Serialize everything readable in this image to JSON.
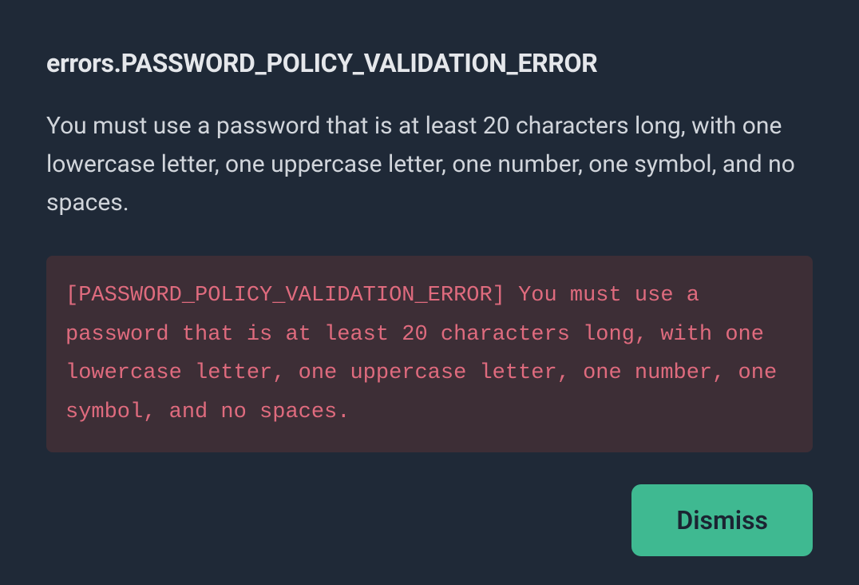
{
  "dialog": {
    "title": "errors.PASSWORD_POLICY_VALIDATION_ERROR",
    "message": "You must use a password that is at least 20 characters long, with one lowercase letter, one uppercase letter, one number, one symbol, and no spaces.",
    "error_detail": "[PASSWORD_POLICY_VALIDATION_ERROR] You must use a password that is at least 20 characters long, with one lowercase letter, one uppercase letter, one number, one symbol, and no spaces.",
    "dismiss_label": "Dismiss"
  },
  "colors": {
    "background": "#1f2937",
    "title_text": "#e5e7eb",
    "body_text": "#d1d5db",
    "error_box_bg": "#3d2e36",
    "error_text": "#df6b7e",
    "button_bg": "#3fb991",
    "button_text": "#1b2432"
  }
}
